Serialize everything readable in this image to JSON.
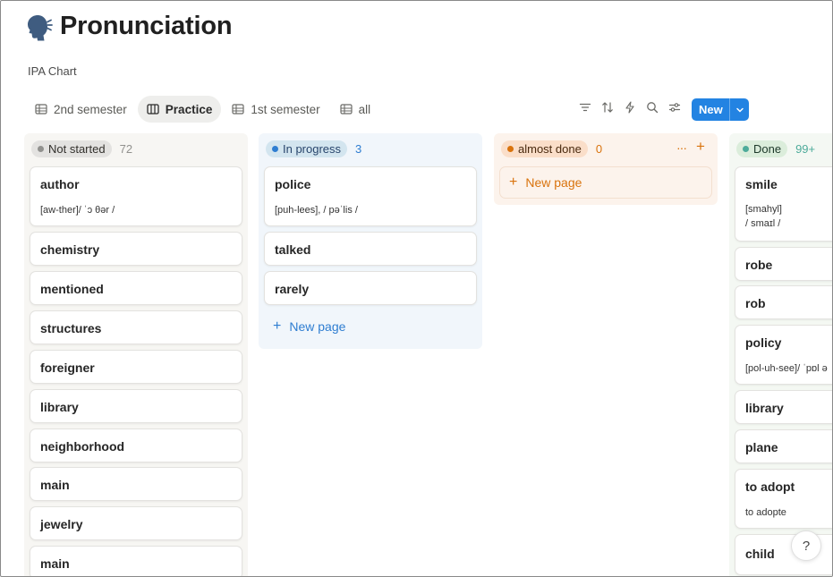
{
  "page": {
    "title": "Pronunciation",
    "subtitle": "IPA Chart"
  },
  "tabs": [
    {
      "label": "2nd semester",
      "icon": "table-icon",
      "active": false
    },
    {
      "label": "Practice",
      "icon": "board-icon",
      "active": true
    },
    {
      "label": "1st semester",
      "icon": "table-icon",
      "active": false
    },
    {
      "label": "all",
      "icon": "table-icon",
      "active": false
    }
  ],
  "toolbar": {
    "icons": [
      "filter-icon",
      "sort-icon",
      "automation-icon",
      "search-icon",
      "settings-icon"
    ],
    "new_label": "New"
  },
  "columns": [
    {
      "name": "Not started",
      "count": "72",
      "dot_color": "#91918e",
      "pill_bg": "#e3e2e0",
      "col_bg": "#f7f6f3",
      "text_color": "#32302c",
      "cards": [
        {
          "title": "author",
          "sub": [
            "[aw-ther]/ ˈɔ θər /"
          ]
        },
        {
          "title": "chemistry"
        },
        {
          "title": "mentioned"
        },
        {
          "title": "structures"
        },
        {
          "title": "foreigner"
        },
        {
          "title": "library"
        },
        {
          "title": "neighborhood"
        },
        {
          "title": "main"
        },
        {
          "title": "jewelry"
        },
        {
          "title": "main"
        }
      ]
    },
    {
      "name": "In progress",
      "count": "3",
      "dot_color": "#2e7dd1",
      "pill_bg": "#d3e5ef",
      "col_bg": "#f1f6fb",
      "text_color": "#28456c",
      "cards": [
        {
          "title": "police",
          "sub": [
            "[puh-lees], / pəˈlis /"
          ]
        },
        {
          "title": "talked"
        },
        {
          "title": "rarely"
        }
      ],
      "new_page": "New page"
    },
    {
      "name": "almost done",
      "count": "0",
      "dot_color": "#d9730d",
      "pill_bg": "#fadec9",
      "col_bg": "#fcf3ec",
      "text_color": "#49290e",
      "cards": [],
      "new_page": "New page"
    },
    {
      "name": "Done",
      "count": "99+",
      "dot_color": "#4dab9a",
      "pill_bg": "#dbeddb",
      "col_bg": "#f4f8f3",
      "text_color": "#1c3829",
      "cards": [
        {
          "title": "smile",
          "sub": [
            "[smahyl]",
            "/ smaɪl /"
          ]
        },
        {
          "title": "robe"
        },
        {
          "title": "rob"
        },
        {
          "title": "policy",
          "sub": [
            "[pol-uh-see]/ ˈpɒl ə"
          ]
        },
        {
          "title": "library"
        },
        {
          "title": "plane"
        },
        {
          "title": "to adopt",
          "sub": [
            "to adopte"
          ]
        },
        {
          "title": "child"
        }
      ]
    }
  ],
  "help_label": "?"
}
